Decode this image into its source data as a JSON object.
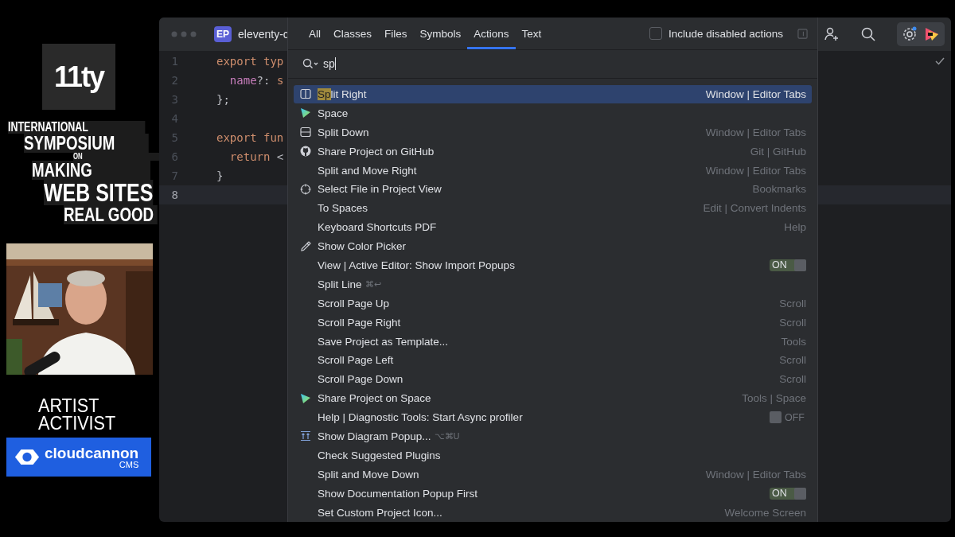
{
  "sidebar": {
    "logo": "11ty",
    "title_lines": [
      "INTERNATIONAL",
      "SYMPOSIUM",
      "ON",
      "MAKING",
      "WEB SITES",
      "REAL GOOD"
    ],
    "video": {
      "kind": "picture"
    },
    "tagline_lines": [
      "ARTIST",
      "ACTIVIST"
    ],
    "sponsor": {
      "name": "cloudcannon",
      "sub": "CMS"
    }
  },
  "ide": {
    "project_badge": "EP",
    "project_name": "eleventy-c",
    "code_lines": [
      {
        "number": "1",
        "current": false,
        "tokens": [
          {
            "text": "export typ",
            "kind": "keyword"
          }
        ]
      },
      {
        "number": "2",
        "current": false,
        "tokens": [
          {
            "text": "  name",
            "kind": "prop"
          },
          {
            "text": "?: ",
            "kind": "plain"
          },
          {
            "text": "s",
            "kind": "keyword"
          }
        ]
      },
      {
        "number": "3",
        "current": false,
        "tokens": [
          {
            "text": "};",
            "kind": "plain"
          }
        ]
      },
      {
        "number": "4",
        "current": false
      },
      {
        "number": "5",
        "current": false,
        "tokens": [
          {
            "text": "export fun",
            "kind": "keyword"
          }
        ]
      },
      {
        "number": "6",
        "current": false,
        "tokens": [
          {
            "text": "  return ",
            "kind": "keyword"
          },
          {
            "text": "<",
            "kind": "plain"
          }
        ]
      },
      {
        "number": "7",
        "current": false,
        "tokens": [
          {
            "text": "}",
            "kind": "plain"
          }
        ]
      },
      {
        "number": "8",
        "current": true
      }
    ]
  },
  "popup": {
    "tabs": [
      {
        "label": "All",
        "selected": false
      },
      {
        "label": "Classes",
        "selected": false
      },
      {
        "label": "Files",
        "selected": false
      },
      {
        "label": "Symbols",
        "selected": false
      },
      {
        "label": "Actions",
        "selected": true
      },
      {
        "label": "Text",
        "selected": false
      }
    ],
    "include_disabled": {
      "label": "Include disabled actions",
      "checked": false
    },
    "search": {
      "value": "sp"
    },
    "results": [
      {
        "match": "Sp",
        "label": "lit Right",
        "kind": "split-vertical",
        "category": "Window | Editor Tabs",
        "selected": true
      },
      {
        "label": "Space",
        "kind": "space",
        "selected": false
      },
      {
        "label": "Split Down",
        "kind": "split-horizontal",
        "category": "Window | Editor Tabs",
        "selected": false
      },
      {
        "label": "Share Project on GitHub",
        "kind": "github",
        "category": "Git | GitHub",
        "selected": false
      },
      {
        "label": "Split and Move Right",
        "category": "Window | Editor Tabs",
        "selected": false
      },
      {
        "label": "Select File in Project View",
        "kind": "target",
        "category": "Bookmarks",
        "selected": false
      },
      {
        "label": "To Spaces",
        "category": "Edit | Convert Indents",
        "selected": false
      },
      {
        "label": "Keyboard Shortcuts PDF",
        "category": "Help",
        "selected": false
      },
      {
        "label": "Show Color Picker",
        "kind": "pipette",
        "selected": false
      },
      {
        "label": "View | Active Editor: Show Import Popups",
        "toggle": {
          "on": true,
          "label": "ON"
        },
        "selected": false
      },
      {
        "label": "Split Line",
        "shortcut": "⌘↩",
        "selected": false
      },
      {
        "label": "Scroll Page Up",
        "category": "Scroll",
        "selected": false
      },
      {
        "label": "Scroll Page Right",
        "category": "Scroll",
        "selected": false
      },
      {
        "label": "Save Project as Template...",
        "category": "Tools",
        "selected": false
      },
      {
        "label": "Scroll Page Left",
        "category": "Scroll",
        "selected": false
      },
      {
        "label": "Scroll Page Down",
        "category": "Scroll",
        "selected": false
      },
      {
        "label": "Share Project on Space",
        "kind": "space",
        "category": "Tools | Space",
        "selected": false
      },
      {
        "label": "Help | Diagnostic Tools: Start Async profiler",
        "toggle": {
          "on": false,
          "label": "OFF"
        },
        "selected": false
      },
      {
        "label": "Show Diagram Popup...",
        "kind": "diagram",
        "shortcut": "⌥⌘U",
        "selected": false
      },
      {
        "label": "Check Suggested Plugins",
        "selected": false
      },
      {
        "label": "Split and Move Down",
        "category": "Window | Editor Tabs",
        "selected": false
      },
      {
        "label": "Show Documentation Popup First",
        "toggle": {
          "on": true,
          "label": "ON"
        },
        "selected": false
      },
      {
        "label": "Set Custom Project Icon...",
        "category": "Welcome Screen",
        "selected": false
      }
    ]
  }
}
